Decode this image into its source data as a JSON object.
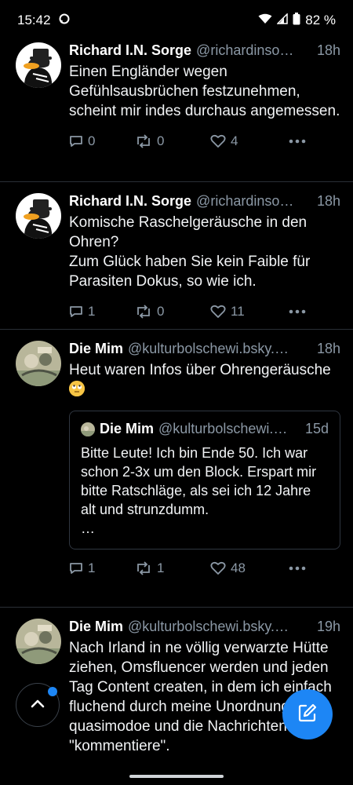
{
  "status": {
    "time": "15:42",
    "battery": "82 %"
  },
  "posts": [
    {
      "author": "Richard I.N. Sorge",
      "handle": "@richardinso…",
      "time": "18h",
      "text": "Einen Engländer wegen Gefühlsausbrüchen festzunehmen, scheint mir indes durchaus angemessen.",
      "replies": "0",
      "reposts": "0",
      "likes": "4"
    },
    {
      "author": "Richard I.N. Sorge",
      "handle": "@richardinso…",
      "time": "18h",
      "text": "Komische Raschelgeräusche in den Ohren?\nZum Glück haben Sie kein Faible für Parasiten Dokus, so wie ich.",
      "replies": "1",
      "reposts": "0",
      "likes": "11"
    },
    {
      "author": "Die Mim",
      "handle": "@kulturbolschewi.bsky.…",
      "time": "18h",
      "text": "Heut waren Infos über Ohrengeräusche",
      "emoji": "🙄",
      "quote": {
        "author": "Die Mim",
        "handle": "@kulturbolschewi.…",
        "time": "15d",
        "text": "Bitte Leute! Ich bin Ende 50. Ich war schon 2-3x um den Block. Erspart mir bitte Ratschläge, als sei ich 12 Jahre alt und strunzdumm.\n…"
      },
      "replies": "1",
      "reposts": "1",
      "likes": "48"
    },
    {
      "author": "Die Mim",
      "handle": "@kulturbolschewi.bsky.…",
      "time": "19h",
      "text": "Nach Irland in ne völlig verwarzte Hütte ziehen, Omsfluencer werden und jeden Tag Content createn, in dem ich einfach fluchend durch meine Unordnung quasimodoe und die Nachrichten \"kommentiere\"."
    }
  ],
  "icons": {
    "reply": "speech-bubble-icon",
    "repost": "repost-icon",
    "like": "heart-icon",
    "more": "ellipsis-icon",
    "scroll_top": "chevron-up-icon",
    "compose": "pencil-square-icon"
  },
  "colors": {
    "accent": "#1d86f5",
    "muted": "#8b98a5",
    "background": "#000000"
  }
}
